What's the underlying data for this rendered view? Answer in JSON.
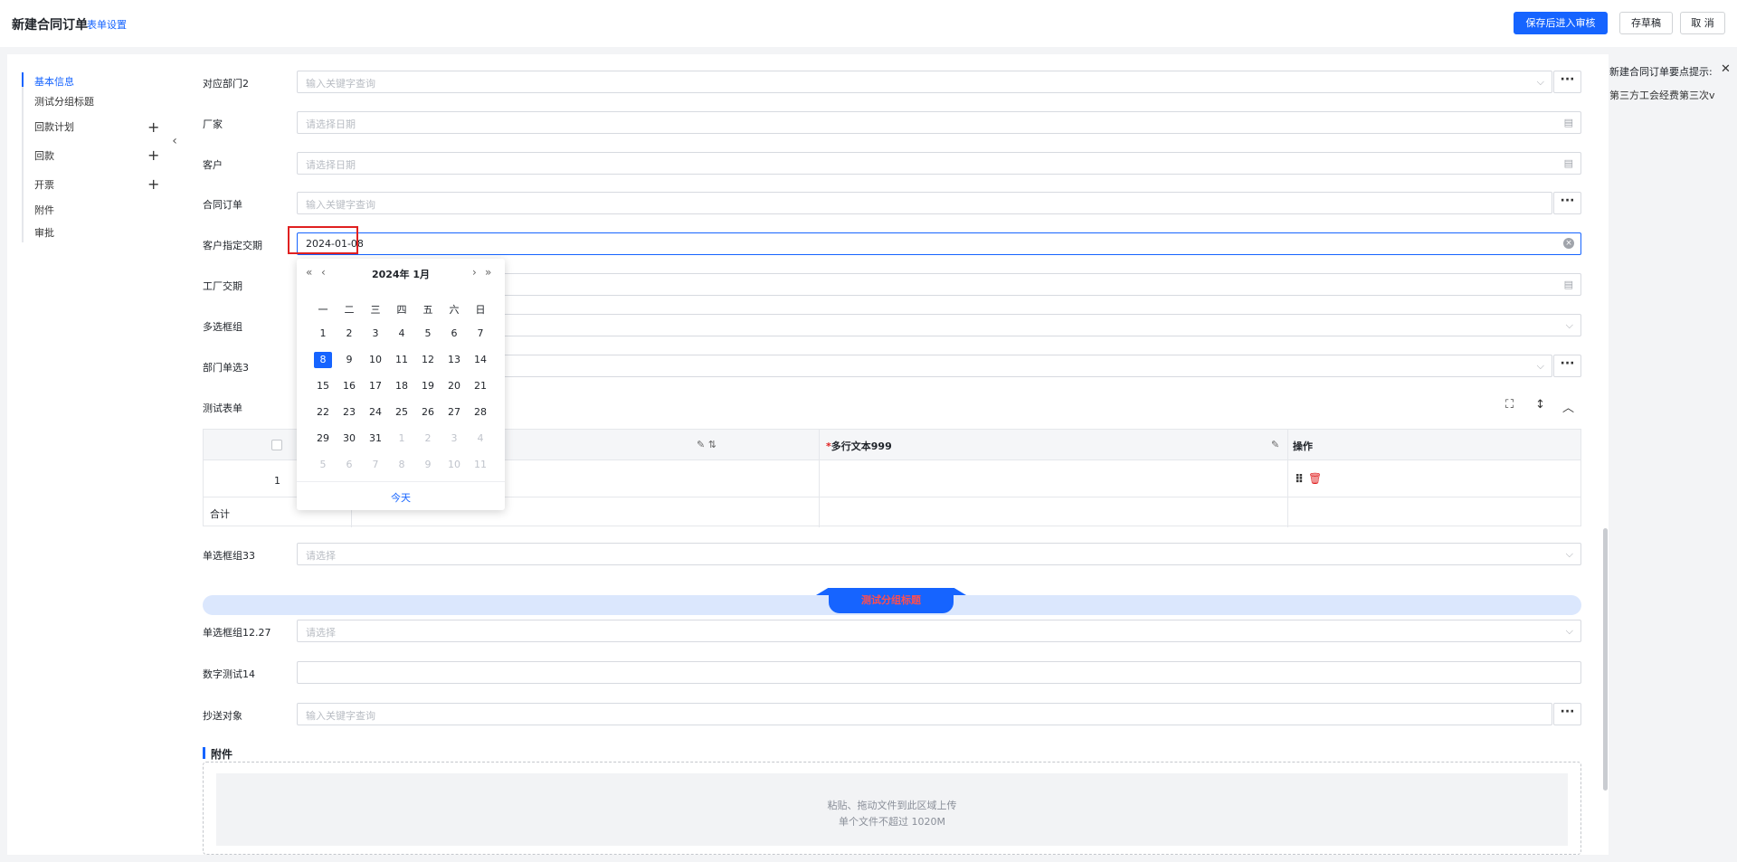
{
  "header": {
    "title": "新建合同订单",
    "form_settings": "表单设置",
    "save_review": "保存后进入审核",
    "save_draft": "存草稿",
    "cancel": "取 消"
  },
  "nav": {
    "items": [
      {
        "label": "基本信息",
        "active": true
      },
      {
        "label": "测试分组标题"
      },
      {
        "label": "回款计划",
        "plus": true
      },
      {
        "label": "回款",
        "plus": true
      },
      {
        "label": "开票",
        "plus": true
      },
      {
        "label": "附件"
      },
      {
        "label": "审批"
      }
    ],
    "collapse_icon": "chevron-left-icon"
  },
  "fields": {
    "dept2": {
      "label": "对应部门2",
      "placeholder": "输入关键字查询"
    },
    "manufacturer": {
      "label": "厂家",
      "placeholder": "请选择日期"
    },
    "customer": {
      "label": "客户",
      "placeholder": "请选择日期"
    },
    "contract_order": {
      "label": "合同订单",
      "placeholder": "输入关键字查询"
    },
    "customer_delivery": {
      "label": "客户指定交期",
      "value": "2024-01-08"
    },
    "factory_delivery": {
      "label": "工厂交期"
    },
    "multi_select": {
      "label": "多选框组"
    },
    "dept_single3": {
      "label": "部门单选3"
    },
    "test_table": {
      "label": "测试表单"
    },
    "radio33": {
      "label": "单选框组33",
      "placeholder": "请选择"
    },
    "radio1227": {
      "label": "单选框组12.27",
      "placeholder": "请选择"
    },
    "number14": {
      "label": "数字测试14"
    },
    "cc": {
      "label": "抄送对象",
      "placeholder": "输入关键字查询"
    }
  },
  "table": {
    "col_multiline": "多行文本999",
    "col_action": "操作",
    "row_index": "1",
    "total_label": "合计"
  },
  "group_title": "测试分组标题",
  "attachment": {
    "title": "附件",
    "hint1": "粘贴、拖动文件到此区域上传",
    "hint2": "单个文件不超过 1020M"
  },
  "tips": {
    "title": "新建合同订单要点提示:",
    "line": "第三方工会经费第三次v"
  },
  "datepicker": {
    "title": "2024年  1月",
    "weekdays": [
      "一",
      "二",
      "三",
      "四",
      "五",
      "六",
      "日"
    ],
    "weeks": [
      [
        {
          "d": "1"
        },
        {
          "d": "2"
        },
        {
          "d": "3"
        },
        {
          "d": "4"
        },
        {
          "d": "5"
        },
        {
          "d": "6"
        },
        {
          "d": "7"
        }
      ],
      [
        {
          "d": "8",
          "sel": true
        },
        {
          "d": "9"
        },
        {
          "d": "10"
        },
        {
          "d": "11"
        },
        {
          "d": "12"
        },
        {
          "d": "13"
        },
        {
          "d": "14"
        }
      ],
      [
        {
          "d": "15"
        },
        {
          "d": "16"
        },
        {
          "d": "17"
        },
        {
          "d": "18"
        },
        {
          "d": "19"
        },
        {
          "d": "20"
        },
        {
          "d": "21"
        }
      ],
      [
        {
          "d": "22"
        },
        {
          "d": "23"
        },
        {
          "d": "24"
        },
        {
          "d": "25"
        },
        {
          "d": "26"
        },
        {
          "d": "27"
        },
        {
          "d": "28"
        }
      ],
      [
        {
          "d": "29"
        },
        {
          "d": "30"
        },
        {
          "d": "31"
        },
        {
          "d": "1",
          "other": true
        },
        {
          "d": "2",
          "other": true
        },
        {
          "d": "3",
          "other": true
        },
        {
          "d": "4",
          "other": true
        }
      ],
      [
        {
          "d": "5",
          "other": true
        },
        {
          "d": "6",
          "other": true
        },
        {
          "d": "7",
          "other": true
        },
        {
          "d": "8",
          "other": true
        },
        {
          "d": "9",
          "other": true
        },
        {
          "d": "10",
          "other": true
        },
        {
          "d": "11",
          "other": true
        }
      ]
    ],
    "today": "今天"
  },
  "colors": {
    "accent": "#1664ff",
    "danger": "#e02020"
  }
}
